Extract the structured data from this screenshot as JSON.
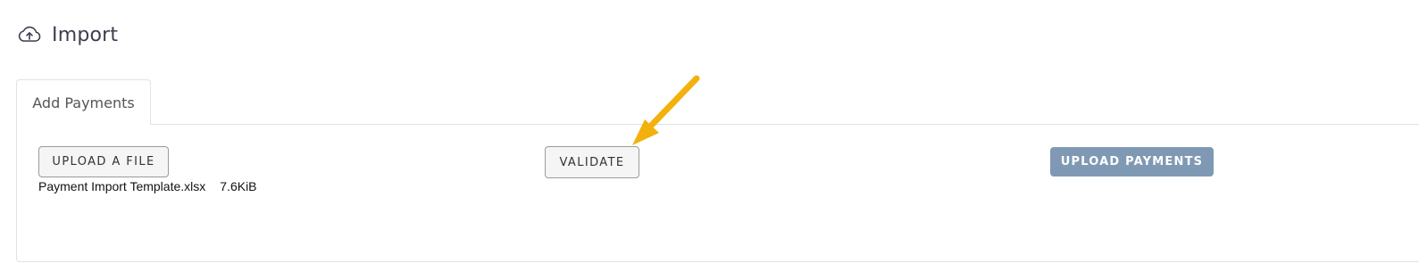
{
  "header": {
    "title": "Import",
    "icon": "cloud-upload-icon"
  },
  "tabs": [
    {
      "label": "Add Payments",
      "active": true
    }
  ],
  "actions": {
    "upload_file_label": "UPLOAD A FILE",
    "validate_label": "VALIDATE",
    "upload_payments_label": "UPLOAD PAYMENTS"
  },
  "file": {
    "name": "Payment Import Template.xlsx",
    "size": "7.6KiB"
  },
  "annotation": {
    "icon": "pointer-arrow-icon",
    "color": "#f2b10c"
  },
  "colors": {
    "primary_button": "#7f99b4",
    "title_text": "#3d3d4e"
  }
}
